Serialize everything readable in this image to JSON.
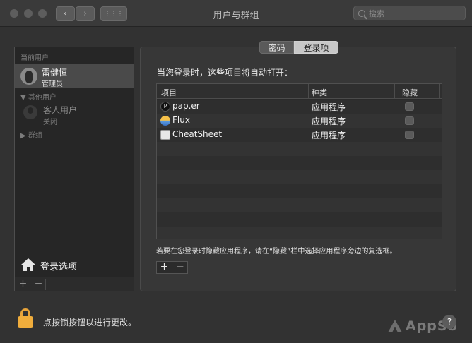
{
  "window": {
    "title": "用户与群组"
  },
  "toolbar": {
    "search_placeholder": "搜索",
    "back_label": "‹",
    "forward_label": "›",
    "grid_label": "⋮⋮⋮"
  },
  "sidebar": {
    "current_users_label": "当前用户",
    "current_user": {
      "name": "雷健恒",
      "role": "管理员"
    },
    "other_users_label": "其他用户",
    "guest_user": {
      "name": "客人用户",
      "status": "关闭"
    },
    "groups_label": "群组",
    "login_options_label": "登录选项",
    "add_label": "+",
    "remove_label": "−"
  },
  "tabs": [
    {
      "label": "密码",
      "active": false
    },
    {
      "label": "登录项",
      "active": true
    }
  ],
  "login_items": {
    "heading": "当您登录时，这些项目将自动打开：",
    "columns": [
      "项目",
      "种类",
      "隐藏"
    ],
    "rows": [
      {
        "name": "pap.er",
        "kind": "应用程序",
        "hidden": false,
        "icon": "paper-app-icon"
      },
      {
        "name": "Flux",
        "kind": "应用程序",
        "hidden": false,
        "icon": "flux-app-icon"
      },
      {
        "name": "CheatSheet",
        "kind": "应用程序",
        "hidden": false,
        "icon": "cheatsheet-app-icon"
      }
    ],
    "hint": "若要在您登录时隐藏应用程序，请在“隐藏”栏中选择应用程序旁边的复选框。",
    "add_label": "+",
    "remove_label": "−"
  },
  "footer": {
    "lock_text": "点按锁按钮以进行更改。",
    "help_label": "?"
  },
  "watermark": {
    "text": "AppSo"
  },
  "colors": {
    "lock": "#f0ad3c",
    "background": "#323232",
    "selected_row": "#4a4a4a"
  }
}
